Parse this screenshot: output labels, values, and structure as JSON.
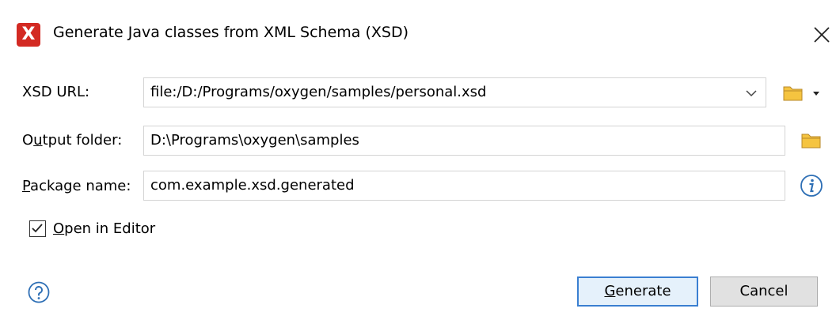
{
  "window": {
    "title": "Generate Java classes from XML Schema (XSD)",
    "app_icon_letter": "X",
    "close_icon": "close-icon"
  },
  "form": {
    "xsd_url": {
      "label": "XSD URL:",
      "value": "file:/D:/Programs/oxygen/samples/personal.xsd"
    },
    "output_folder": {
      "label_pre": "O",
      "label_mnemonic": "u",
      "label_post": "tput folder:",
      "value": "D:\\Programs\\oxygen\\samples"
    },
    "package_name": {
      "label_mnemonic": "P",
      "label_post": "ackage name:",
      "value": "com.example.xsd.generated"
    },
    "open_in_editor": {
      "label_mnemonic": "O",
      "label_post": "pen in Editor",
      "checked": true
    }
  },
  "buttons": {
    "generate_mnemonic": "G",
    "generate_post": "enerate",
    "cancel": "Cancel"
  },
  "colors": {
    "accent": "#3a7fd1",
    "folder": "#f5c440",
    "brand_red": "#d32a23",
    "info_blue": "#2e6fb5"
  }
}
